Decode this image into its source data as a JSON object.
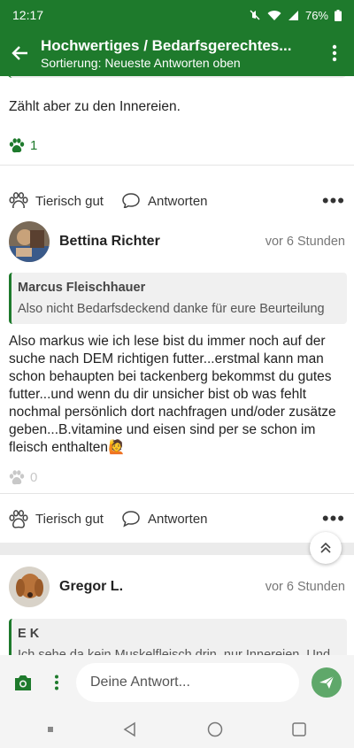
{
  "status_bar": {
    "time": "12:17",
    "battery": "76%"
  },
  "app_bar": {
    "title": "Hochwertiges / Bedarfsgerechtes...",
    "subtitle": "Sortierung: Neueste Antworten oben",
    "icons": {
      "back": "arrow-left-icon",
      "menu": "more-vert-icon"
    }
  },
  "posts": [
    {
      "text": "Zählt aber zu den Innereien.",
      "likes": "1",
      "like_label": "Tierisch gut",
      "reply_label": "Antworten"
    },
    {
      "author": "Bettina Richter",
      "time": "vor 6 Stunden",
      "quote": {
        "author": "Marcus Fleischhauer",
        "text": "Also nicht Bedarfsdeckend danke für eure Beurteilung"
      },
      "text": "Also markus wie ich lese bist du immer noch auf der suche nach DEM richtigen futter...erstmal kann man schon behaupten bei tackenberg bekommst du gutes futter...und wenn du dir unsicher bist ob was fehlt nochmal persönlich dort nachfragen und/oder zusätze geben...B.vitamine und eisen sind per se schon im fleisch enthalten🙋",
      "likes": "0",
      "like_label": "Tierisch gut",
      "reply_label": "Antworten"
    },
    {
      "author": "Gregor L.",
      "time": "vor 6 Stunden",
      "quote": {
        "author": "E K",
        "text": "Ich sehe da kein Muskelfleisch drin, nur Innereien. Und"
      }
    }
  ],
  "composer": {
    "placeholder": "Deine Antwort..."
  },
  "colors": {
    "brand_green": "#1e7a2c",
    "send_button": "#5fa86a",
    "background": "#ebebeb"
  }
}
